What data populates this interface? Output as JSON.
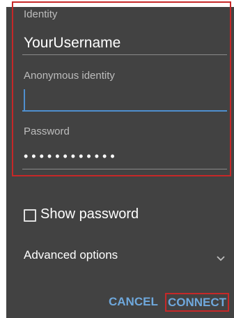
{
  "form": {
    "identity_label": "Identity",
    "identity_value": "YourUsername",
    "anonymous_label": "Anonymous identity",
    "anonymous_value": "",
    "password_label": "Password",
    "password_mask": "••••••••••••"
  },
  "options": {
    "show_password_label": "Show password",
    "show_password_checked": false,
    "advanced_label": "Advanced options"
  },
  "actions": {
    "cancel_label": "CANCEL",
    "connect_label": "CONNECT"
  },
  "icons": {
    "expand": "chevron-down-icon",
    "checkbox": "checkbox-icon"
  },
  "colors": {
    "dialog_bg": "#424242",
    "accent": "#6fa8dc",
    "highlight": "#c62828"
  }
}
